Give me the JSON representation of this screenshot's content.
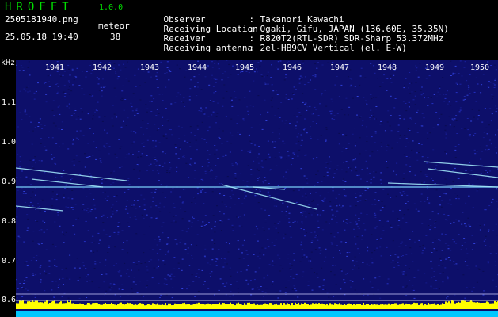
{
  "header": {
    "app_title": "HROFFT",
    "app_version": "1.0.0",
    "filename": "2505181940.png",
    "detect_label": "meteor",
    "datetime": "25.05.18 19:40",
    "detect_count": "38"
  },
  "station": {
    "rows": [
      {
        "label": "Observer",
        "value": "Takanori Kawachi"
      },
      {
        "label": "Receiving Location",
        "value": "Ogaki, Gifu, JAPAN (136.60E, 35.35N)"
      },
      {
        "label": "Receiver",
        "value": "R820T2(RTL-SDR) SDR-Sharp 53.372MHz"
      },
      {
        "label": "Receiving antenna",
        "value": "2el-HB9CV Vertical (el. E-W)"
      }
    ]
  },
  "axes": {
    "unit": "kHz",
    "x_ticks": [
      "1941",
      "1942",
      "1943",
      "1944",
      "1945",
      "1946",
      "1947",
      "1948",
      "1949",
      "1950"
    ],
    "y_ticks": [
      "1.1",
      "1.0",
      "0.9",
      "0.8",
      "0.7",
      "0.6"
    ]
  },
  "colors": {
    "background": "#0d0f6a",
    "echo": "#a8f0ff",
    "signal_bar": "#ffff00",
    "base_bar": "#00c8ff"
  }
}
